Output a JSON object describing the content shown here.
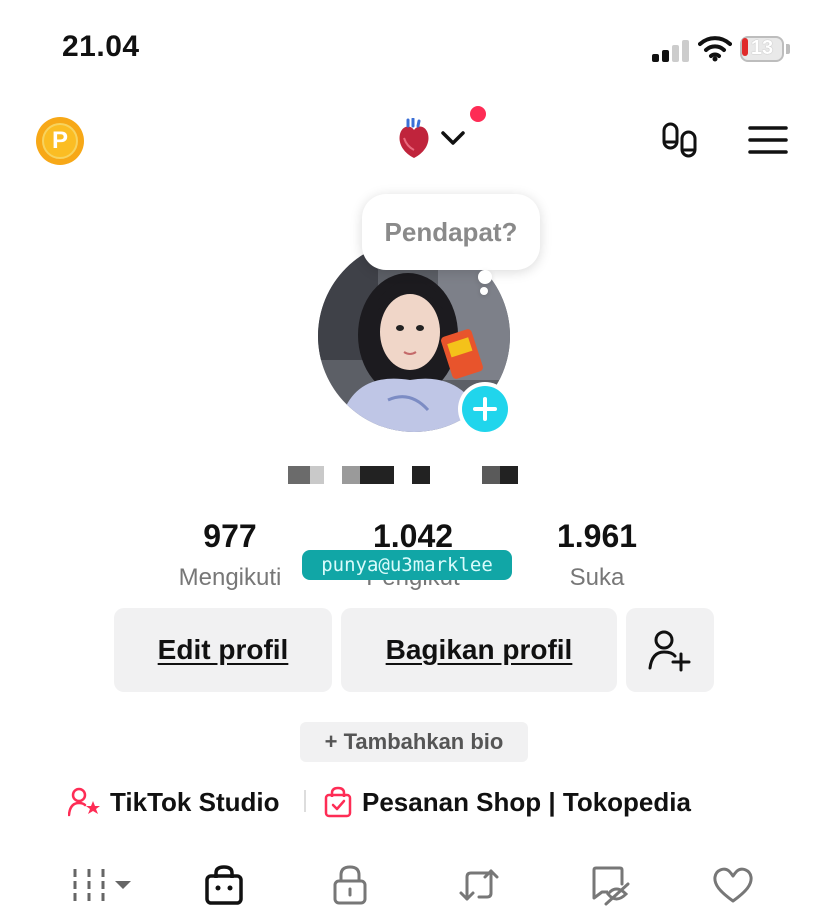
{
  "status_bar": {
    "time": "21.04",
    "battery": "13"
  },
  "top_nav": {
    "coin_letter": "P"
  },
  "profile": {
    "bubble_text": "Pendapat?",
    "watermark": "punya@u3marklee"
  },
  "stats": [
    {
      "value": "977",
      "label": "Mengikuti"
    },
    {
      "value": "1.042",
      "label": "Pengikut"
    },
    {
      "value": "1.961",
      "label": "Suka"
    }
  ],
  "actions": {
    "edit_profile": "Edit profil",
    "share_profile": "Bagikan profil",
    "add_bio": "+ Tambahkan bio"
  },
  "links": {
    "studio": "TikTok Studio",
    "shop": "Pesanan Shop | Tokopedia"
  },
  "tabs": [
    "grid-icon",
    "shop-bag-icon",
    "lock-icon",
    "repost-icon",
    "tagged-icon",
    "heart-icon"
  ],
  "colors": {
    "accent": "#fe2c55",
    "plus_badge": "#20d5ec",
    "coin": "#f7a817"
  }
}
